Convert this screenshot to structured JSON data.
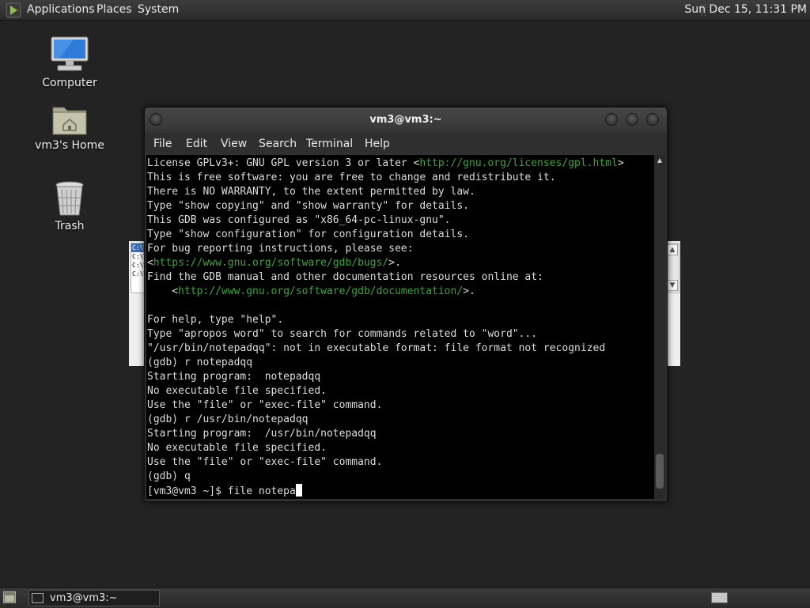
{
  "top_panel": {
    "menus": [
      "Applications",
      "Places",
      "System"
    ],
    "clock": "Sun Dec 15, 11:31 PM"
  },
  "desktop_icons": [
    {
      "label": "Computer",
      "icon": "computer-icon"
    },
    {
      "label": "vm3's Home",
      "icon": "home-folder-icon"
    },
    {
      "label": "Trash",
      "icon": "trash-icon"
    }
  ],
  "background_window": {
    "rows": [
      "C:\\W",
      "C:\\W",
      "C:\\W",
      "C:\\W"
    ]
  },
  "terminal": {
    "title": "vm3@vm3:~",
    "menus": [
      "File",
      "Edit",
      "View",
      "Search",
      "Terminal",
      "Help"
    ],
    "lines": [
      [
        {
          "t": "License GPLv3+: GNU GPL version 3 or later <"
        },
        {
          "t": "http://gnu.org/licenses/gpl.html",
          "url": true
        },
        {
          "t": ">"
        }
      ],
      [
        {
          "t": "This is free software: you are free to change and redistribute it."
        }
      ],
      [
        {
          "t": "There is NO WARRANTY, to the extent permitted by law."
        }
      ],
      [
        {
          "t": "Type \"show copying\" and \"show warranty\" for details."
        }
      ],
      [
        {
          "t": "This GDB was configured as \"x86_64-pc-linux-gnu\"."
        }
      ],
      [
        {
          "t": "Type \"show configuration\" for configuration details."
        }
      ],
      [
        {
          "t": "For bug reporting instructions, please see:"
        }
      ],
      [
        {
          "t": "<"
        },
        {
          "t": "https://www.gnu.org/software/gdb/bugs/",
          "url": true
        },
        {
          "t": ">."
        }
      ],
      [
        {
          "t": "Find the GDB manual and other documentation resources online at:"
        }
      ],
      [
        {
          "t": "    <"
        },
        {
          "t": "http://www.gnu.org/software/gdb/documentation/",
          "url": true
        },
        {
          "t": ">."
        }
      ],
      [
        {
          "t": ""
        }
      ],
      [
        {
          "t": "For help, type \"help\"."
        }
      ],
      [
        {
          "t": "Type \"apropos word\" to search for commands related to \"word\"..."
        }
      ],
      [
        {
          "t": "\"/usr/bin/notepadqq\": not in executable format: file format not recognized"
        }
      ],
      [
        {
          "t": "(gdb) r notepadqq"
        }
      ],
      [
        {
          "t": "Starting program:  notepadqq"
        }
      ],
      [
        {
          "t": "No executable file specified."
        }
      ],
      [
        {
          "t": "Use the \"file\" or \"exec-file\" command."
        }
      ],
      [
        {
          "t": "(gdb) r /usr/bin/notepadqq"
        }
      ],
      [
        {
          "t": "Starting program:  /usr/bin/notepadqq"
        }
      ],
      [
        {
          "t": "No executable file specified."
        }
      ],
      [
        {
          "t": "Use the \"file\" or \"exec-file\" command."
        }
      ],
      [
        {
          "t": "(gdb) q"
        }
      ],
      [
        {
          "t": "[vm3@vm3 ~]$ file notepa"
        }
      ]
    ],
    "colors": {
      "url": "#3fa33f",
      "text": "#dddddd",
      "background": "#000000"
    }
  },
  "taskbar": {
    "task_label": "vm3@vm3:~"
  }
}
